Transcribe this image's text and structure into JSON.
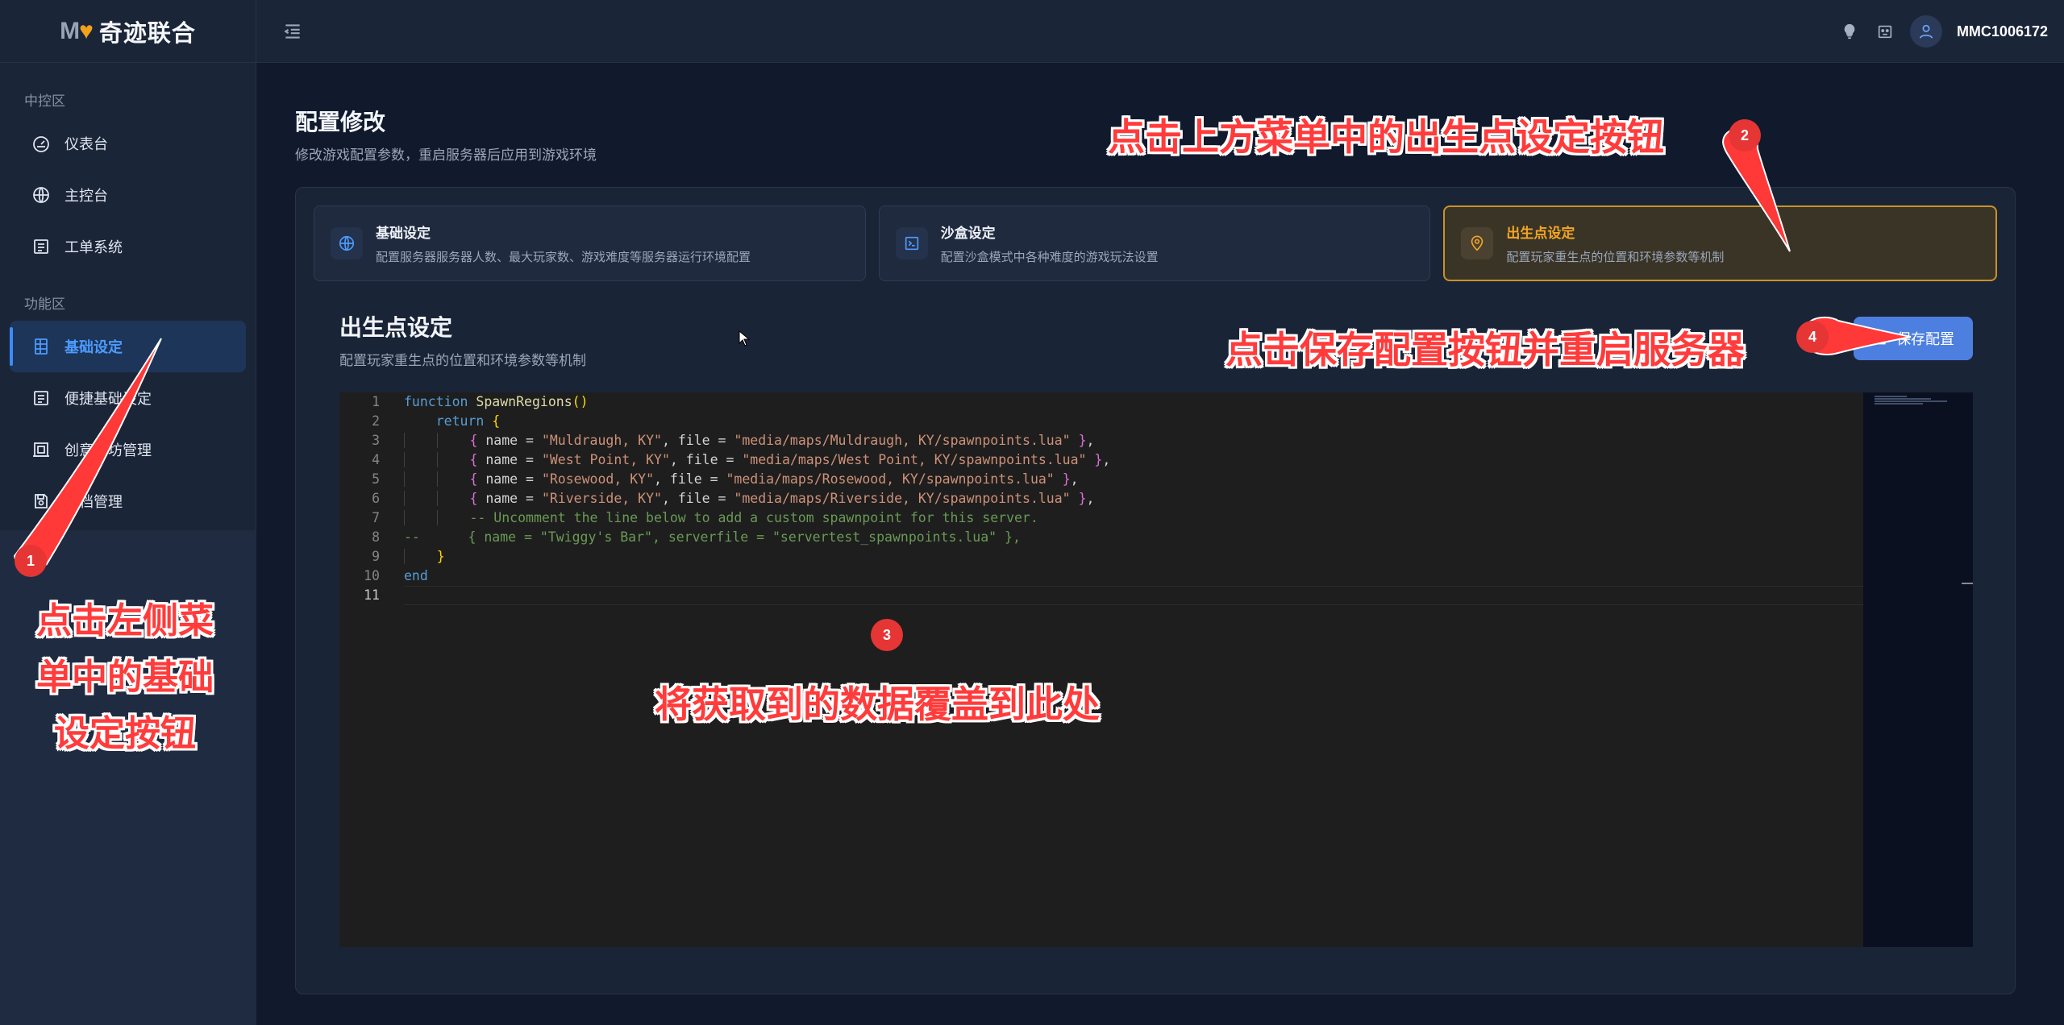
{
  "app": {
    "logo_mark": "M",
    "logo_text": "奇迹联合",
    "username": "MMC1006172"
  },
  "sidebar": {
    "sections": [
      {
        "label": "中控区",
        "items": [
          {
            "label": "仪表台",
            "icon": "dashboard-icon"
          },
          {
            "label": "主控台",
            "icon": "globe-icon"
          },
          {
            "label": "工单系统",
            "icon": "list-icon"
          }
        ]
      },
      {
        "label": "功能区",
        "items": [
          {
            "label": "基础设定",
            "icon": "table-icon",
            "active": true
          },
          {
            "label": "便捷基础设定",
            "icon": "list-icon"
          },
          {
            "label": "创意工坊管理",
            "icon": "building-icon"
          },
          {
            "label": "存档管理",
            "icon": "save-icon"
          }
        ]
      }
    ]
  },
  "page": {
    "title": "配置修改",
    "subtitle": "修改游戏配置参数，重启服务器后应用到游戏环境"
  },
  "tabs": [
    {
      "title": "基础设定",
      "desc": "配置服务器服务器人数、最大玩家数、游戏难度等服务器运行环境配置",
      "icon": "globe-icon"
    },
    {
      "title": "沙盒设定",
      "desc": "配置沙盒模式中各种难度的游戏玩法设置",
      "icon": "terminal-icon"
    },
    {
      "title": "出生点设定",
      "desc": "配置玩家重生点的位置和环境参数等机制",
      "icon": "location-icon",
      "active": true
    }
  ],
  "section": {
    "title": "出生点设定",
    "subtitle": "配置玩家重生点的位置和环境参数等机制",
    "save_label": "保存配置"
  },
  "editor": {
    "line_numbers": [
      "1",
      "2",
      "3",
      "4",
      "5",
      "6",
      "7",
      "8",
      "9",
      "10",
      "11"
    ],
    "current_line": 11,
    "lines": {
      "l1_kw": "function",
      "l1_fn": "SpawnRegions",
      "l2_kw": "return",
      "name_key": "name",
      "file_key": "file",
      "serverfile_key": "serverfile",
      "r1_name": "\"Muldraugh, KY\"",
      "r1_file": "\"media/maps/Muldraugh, KY/spawnpoints.lua\"",
      "r2_name": "\"West Point, KY\"",
      "r2_file": "\"media/maps/West Point, KY/spawnpoints.lua\"",
      "r3_name": "\"Rosewood, KY\"",
      "r3_file": "\"media/maps/Rosewood, KY/spawnpoints.lua\"",
      "r4_name": "\"Riverside, KY\"",
      "r4_file": "\"media/maps/Riverside, KY/spawnpoints.lua\"",
      "l7_comment": "-- Uncomment the line below to add a custom spawnpoint for this server.",
      "l8_comment": "--      { name = \"Twiggy's Bar\", serverfile = \"servertest_spawnpoints.lua\" },",
      "l10_kw": "end"
    }
  },
  "annotations": {
    "step1_badge": "1",
    "step1_lines": [
      "点击左侧菜",
      "单中的基础",
      "设定按钮"
    ],
    "step2_badge": "2",
    "step2_text": "点击上方菜单中的出生点设定按钮",
    "step3_badge": "3",
    "step3_text": "将获取到的数据覆盖到此处",
    "step4_badge": "4",
    "step4_text": "点击保存配置按钮并重启服务器",
    "color": "#ff3b3b"
  }
}
